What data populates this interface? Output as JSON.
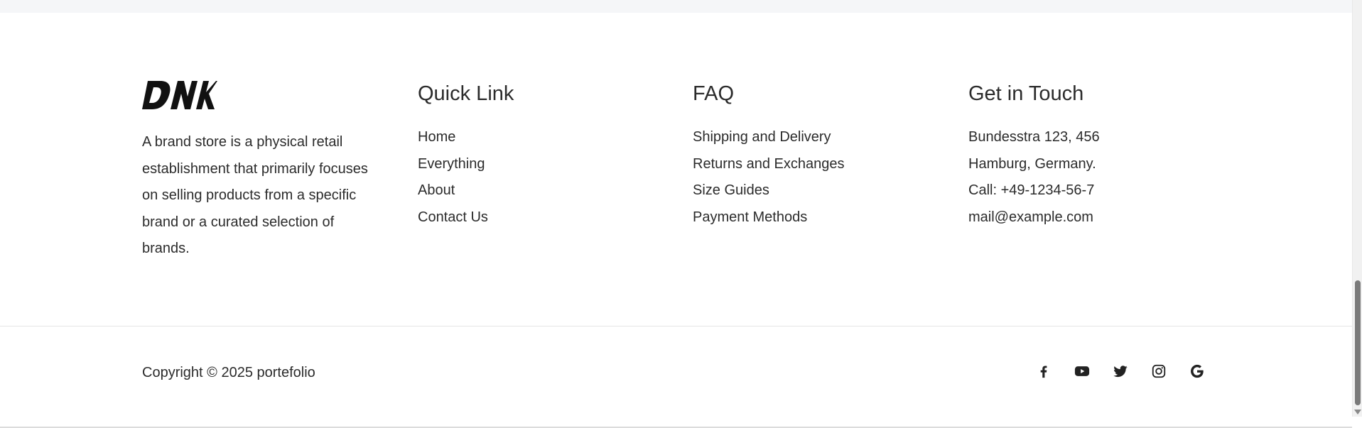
{
  "brand": {
    "logo_text": "DNK",
    "description": "A brand store is a physical retail establishment that primarily focuses on selling products from a specific brand or a curated selection of brands."
  },
  "quick_links": {
    "title": "Quick Link",
    "items": [
      "Home",
      "Everything",
      "About",
      "Contact Us"
    ]
  },
  "faq": {
    "title": "FAQ",
    "items": [
      "Shipping and Delivery",
      "Returns and Exchanges",
      "Size Guides",
      "Payment Methods"
    ]
  },
  "contact": {
    "title": "Get in Touch",
    "items": [
      "Bundesstra 123, 456",
      "Hamburg, Germany.",
      "Call: +49-1234-56-7",
      "mail@example.com"
    ]
  },
  "bottom": {
    "copyright": "Copyright © 2025 portefolio",
    "social_icons": [
      "facebook-icon",
      "youtube-icon",
      "twitter-icon",
      "instagram-icon",
      "google-icon"
    ]
  },
  "colors": {
    "text": "#2b2b2b",
    "top_strip": "#f5f6f8",
    "divider": "#e6e6e6"
  }
}
